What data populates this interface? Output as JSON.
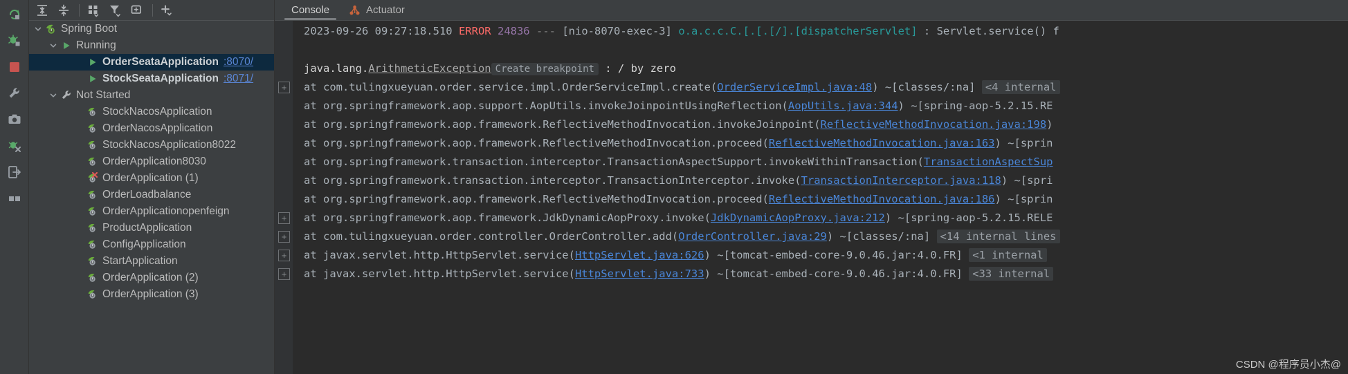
{
  "rail": {
    "items": [
      {
        "name": "rerun-icon",
        "title": "Rerun"
      },
      {
        "name": "debug-icon",
        "title": "Debug"
      },
      {
        "name": "stop-icon",
        "title": "Stop"
      },
      {
        "name": "settings-wrench-icon",
        "title": "Settings"
      },
      {
        "name": "camera-icon",
        "title": "Screenshot"
      },
      {
        "name": "profiler-icon",
        "title": "Profiler"
      },
      {
        "name": "exit-icon",
        "title": "Exit"
      },
      {
        "name": "layout-icon",
        "title": "Layout"
      }
    ]
  },
  "tree_toolbar": {
    "buttons": [
      {
        "name": "expand-all-button",
        "title": "Expand All"
      },
      {
        "name": "collapse-all-button",
        "title": "Collapse All"
      },
      {
        "name": "group-by-button",
        "title": "Group By"
      },
      {
        "name": "filter-button",
        "title": "Filter"
      },
      {
        "name": "add-tab-button",
        "title": "Add Tab"
      },
      {
        "name": "add-service-button",
        "title": "Add Service"
      }
    ]
  },
  "tree": {
    "nodes": [
      {
        "label": "Spring Boot",
        "port": "",
        "icon": "spring-boot-icon",
        "chevron": "down",
        "indent": 0,
        "selected": false,
        "bold": false
      },
      {
        "label": "Running",
        "port": "",
        "icon": "run-triangle-icon",
        "chevron": "down",
        "indent": 1,
        "selected": false,
        "bold": false
      },
      {
        "label": "OrderSeataApplication",
        "port": ":8070/",
        "icon": "run-triangle-icon",
        "chevron": "none",
        "indent": 2,
        "selected": true,
        "bold": true
      },
      {
        "label": "StockSeataApplication",
        "port": ":8071/",
        "icon": "run-triangle-icon",
        "chevron": "none",
        "indent": 2,
        "selected": false,
        "bold": true
      },
      {
        "label": "Not Started",
        "port": "",
        "icon": "wrench-icon",
        "chevron": "down",
        "indent": 1,
        "selected": false,
        "bold": false
      },
      {
        "label": "StockNacosApplication",
        "port": "",
        "icon": "spring-leaf-icon",
        "chevron": "none",
        "indent": 2,
        "selected": false,
        "bold": false
      },
      {
        "label": "OrderNacosApplication",
        "port": "",
        "icon": "spring-leaf-icon",
        "chevron": "none",
        "indent": 2,
        "selected": false,
        "bold": false
      },
      {
        "label": "StockNacosApplication8022",
        "port": "",
        "icon": "spring-leaf-icon",
        "chevron": "none",
        "indent": 2,
        "selected": false,
        "bold": false
      },
      {
        "label": "OrderApplication8030",
        "port": "",
        "icon": "spring-leaf-icon",
        "chevron": "none",
        "indent": 2,
        "selected": false,
        "bold": false
      },
      {
        "label": "OrderApplication (1)",
        "port": "",
        "icon": "spring-leaf-error-icon",
        "chevron": "none",
        "indent": 2,
        "selected": false,
        "bold": false
      },
      {
        "label": "OrderLoadbalance",
        "port": "",
        "icon": "spring-leaf-icon",
        "chevron": "none",
        "indent": 2,
        "selected": false,
        "bold": false
      },
      {
        "label": "OrderApplicationopenfeign",
        "port": "",
        "icon": "spring-leaf-icon",
        "chevron": "none",
        "indent": 2,
        "selected": false,
        "bold": false
      },
      {
        "label": "ProductApplication",
        "port": "",
        "icon": "spring-leaf-icon",
        "chevron": "none",
        "indent": 2,
        "selected": false,
        "bold": false
      },
      {
        "label": "ConfigApplication",
        "port": "",
        "icon": "spring-leaf-icon",
        "chevron": "none",
        "indent": 2,
        "selected": false,
        "bold": false
      },
      {
        "label": "StartApplication",
        "port": "",
        "icon": "spring-leaf-icon",
        "chevron": "none",
        "indent": 2,
        "selected": false,
        "bold": false
      },
      {
        "label": "OrderApplication (2)",
        "port": "",
        "icon": "spring-leaf-icon",
        "chevron": "none",
        "indent": 2,
        "selected": false,
        "bold": false
      },
      {
        "label": "OrderApplication (3)",
        "port": "",
        "icon": "spring-leaf-icon",
        "chevron": "none",
        "indent": 2,
        "selected": false,
        "bold": false
      }
    ]
  },
  "tabs": [
    {
      "label": "Console",
      "icon": "none",
      "active": true
    },
    {
      "label": "Actuator",
      "icon": "actuator-icon",
      "active": false
    }
  ],
  "console": {
    "lines": [
      {
        "name": "log-line-error-header",
        "fold": false,
        "parts": [
          {
            "t": "2023-09-26 09:27:18.510 ",
            "c": "c-gray"
          },
          {
            "t": "ERROR",
            "c": "c-red"
          },
          {
            "t": " ",
            "c": "c-gray"
          },
          {
            "t": "24836",
            "c": "c-purple"
          },
          {
            "t": " --- ",
            "c": "c-dim"
          },
          {
            "t": "[nio-8070-exec-3]",
            "c": "c-gray"
          },
          {
            "t": " ",
            "c": "c-gray"
          },
          {
            "t": "o.a.c.c.C.[.[.[/].[dispatcherServlet]",
            "c": "c-teal"
          },
          {
            "t": "   : Servlet.service() f",
            "c": "c-gray"
          }
        ]
      },
      {
        "name": "log-line-blank",
        "fold": false,
        "parts": []
      },
      {
        "name": "log-line-exception",
        "fold": false,
        "parts": [
          {
            "t": "java.lang.",
            "c": "c-white"
          },
          {
            "t": "ArithmeticException",
            "c": "c-exc"
          },
          {
            "t": "Create breakpoint",
            "c": "chip"
          },
          {
            "t": " : / by zero",
            "c": "c-white"
          }
        ]
      },
      {
        "name": "log-line-stack-1",
        "fold": true,
        "parts": [
          {
            "t": "    at com.tulingxueyuan.order.service.impl.OrderServiceImpl.create(",
            "c": "c-gray"
          },
          {
            "t": "OrderServiceImpl.java:48",
            "c": "c-link"
          },
          {
            "t": ") ~[classes/:na] ",
            "c": "c-gray"
          },
          {
            "t": "<4 internal",
            "c": "fold"
          }
        ]
      },
      {
        "name": "log-line-stack-2",
        "fold": false,
        "parts": [
          {
            "t": "    at org.springframework.aop.support.AopUtils.invokeJoinpointUsingReflection(",
            "c": "c-gray"
          },
          {
            "t": "AopUtils.java:344",
            "c": "c-link"
          },
          {
            "t": ") ~[spring-aop-5.2.15.RE",
            "c": "c-gray"
          }
        ]
      },
      {
        "name": "log-line-stack-3",
        "fold": false,
        "parts": [
          {
            "t": "    at org.springframework.aop.framework.ReflectiveMethodInvocation.invokeJoinpoint(",
            "c": "c-gray"
          },
          {
            "t": "ReflectiveMethodInvocation.java:198",
            "c": "c-link"
          },
          {
            "t": ")",
            "c": "c-gray"
          }
        ]
      },
      {
        "name": "log-line-stack-4",
        "fold": false,
        "parts": [
          {
            "t": "    at org.springframework.aop.framework.ReflectiveMethodInvocation.proceed(",
            "c": "c-gray"
          },
          {
            "t": "ReflectiveMethodInvocation.java:163",
            "c": "c-link"
          },
          {
            "t": ") ~[sprin",
            "c": "c-gray"
          }
        ]
      },
      {
        "name": "log-line-stack-5",
        "fold": false,
        "parts": [
          {
            "t": "    at org.springframework.transaction.interceptor.TransactionAspectSupport.invokeWithinTransaction(",
            "c": "c-gray"
          },
          {
            "t": "TransactionAspectSup",
            "c": "c-link"
          }
        ]
      },
      {
        "name": "log-line-stack-6",
        "fold": false,
        "parts": [
          {
            "t": "    at org.springframework.transaction.interceptor.TransactionInterceptor.invoke(",
            "c": "c-gray"
          },
          {
            "t": "TransactionInterceptor.java:118",
            "c": "c-link"
          },
          {
            "t": ") ~[spri",
            "c": "c-gray"
          }
        ]
      },
      {
        "name": "log-line-stack-7",
        "fold": false,
        "parts": [
          {
            "t": "    at org.springframework.aop.framework.ReflectiveMethodInvocation.proceed(",
            "c": "c-gray"
          },
          {
            "t": "ReflectiveMethodInvocation.java:186",
            "c": "c-link"
          },
          {
            "t": ") ~[sprin",
            "c": "c-gray"
          }
        ]
      },
      {
        "name": "log-line-stack-8",
        "fold": true,
        "parts": [
          {
            "t": "    at org.springframework.aop.framework.JdkDynamicAopProxy.invoke(",
            "c": "c-gray"
          },
          {
            "t": "JdkDynamicAopProxy.java:212",
            "c": "c-link"
          },
          {
            "t": ") ~[spring-aop-5.2.15.RELE",
            "c": "c-gray"
          }
        ]
      },
      {
        "name": "log-line-stack-9",
        "fold": true,
        "parts": [
          {
            "t": "    at com.tulingxueyuan.order.controller.OrderController.add(",
            "c": "c-gray"
          },
          {
            "t": "OrderController.java:29",
            "c": "c-link"
          },
          {
            "t": ") ~[classes/:na] ",
            "c": "c-gray"
          },
          {
            "t": "<14 internal lines",
            "c": "fold"
          }
        ]
      },
      {
        "name": "log-line-stack-10",
        "fold": true,
        "parts": [
          {
            "t": "    at javax.servlet.http.HttpServlet.service(",
            "c": "c-gray"
          },
          {
            "t": "HttpServlet.java:626",
            "c": "c-link"
          },
          {
            "t": ") ~[tomcat-embed-core-9.0.46.jar:4.0.FR] ",
            "c": "c-gray"
          },
          {
            "t": "<1 internal",
            "c": "fold"
          }
        ]
      },
      {
        "name": "log-line-stack-11",
        "fold": true,
        "parts": [
          {
            "t": "    at javax.servlet.http.HttpServlet.service(",
            "c": "c-gray"
          },
          {
            "t": "HttpServlet.java:733",
            "c": "c-link"
          },
          {
            "t": ") ~[tomcat-embed-core-9.0.46.jar:4.0.FR] ",
            "c": "c-gray"
          },
          {
            "t": "<33 internal",
            "c": "fold"
          }
        ]
      }
    ]
  },
  "watermark": {
    "text": "CSDN @程序员小杰@"
  },
  "colors": {
    "panel_bg": "#3c3f41",
    "console_bg": "#2b2b2b",
    "selection": "#0d293e",
    "link": "#4a86d8",
    "error": "#ff6b68",
    "teal": "#299999",
    "purple": "#9876aa",
    "spring_green": "#6aab3c"
  }
}
